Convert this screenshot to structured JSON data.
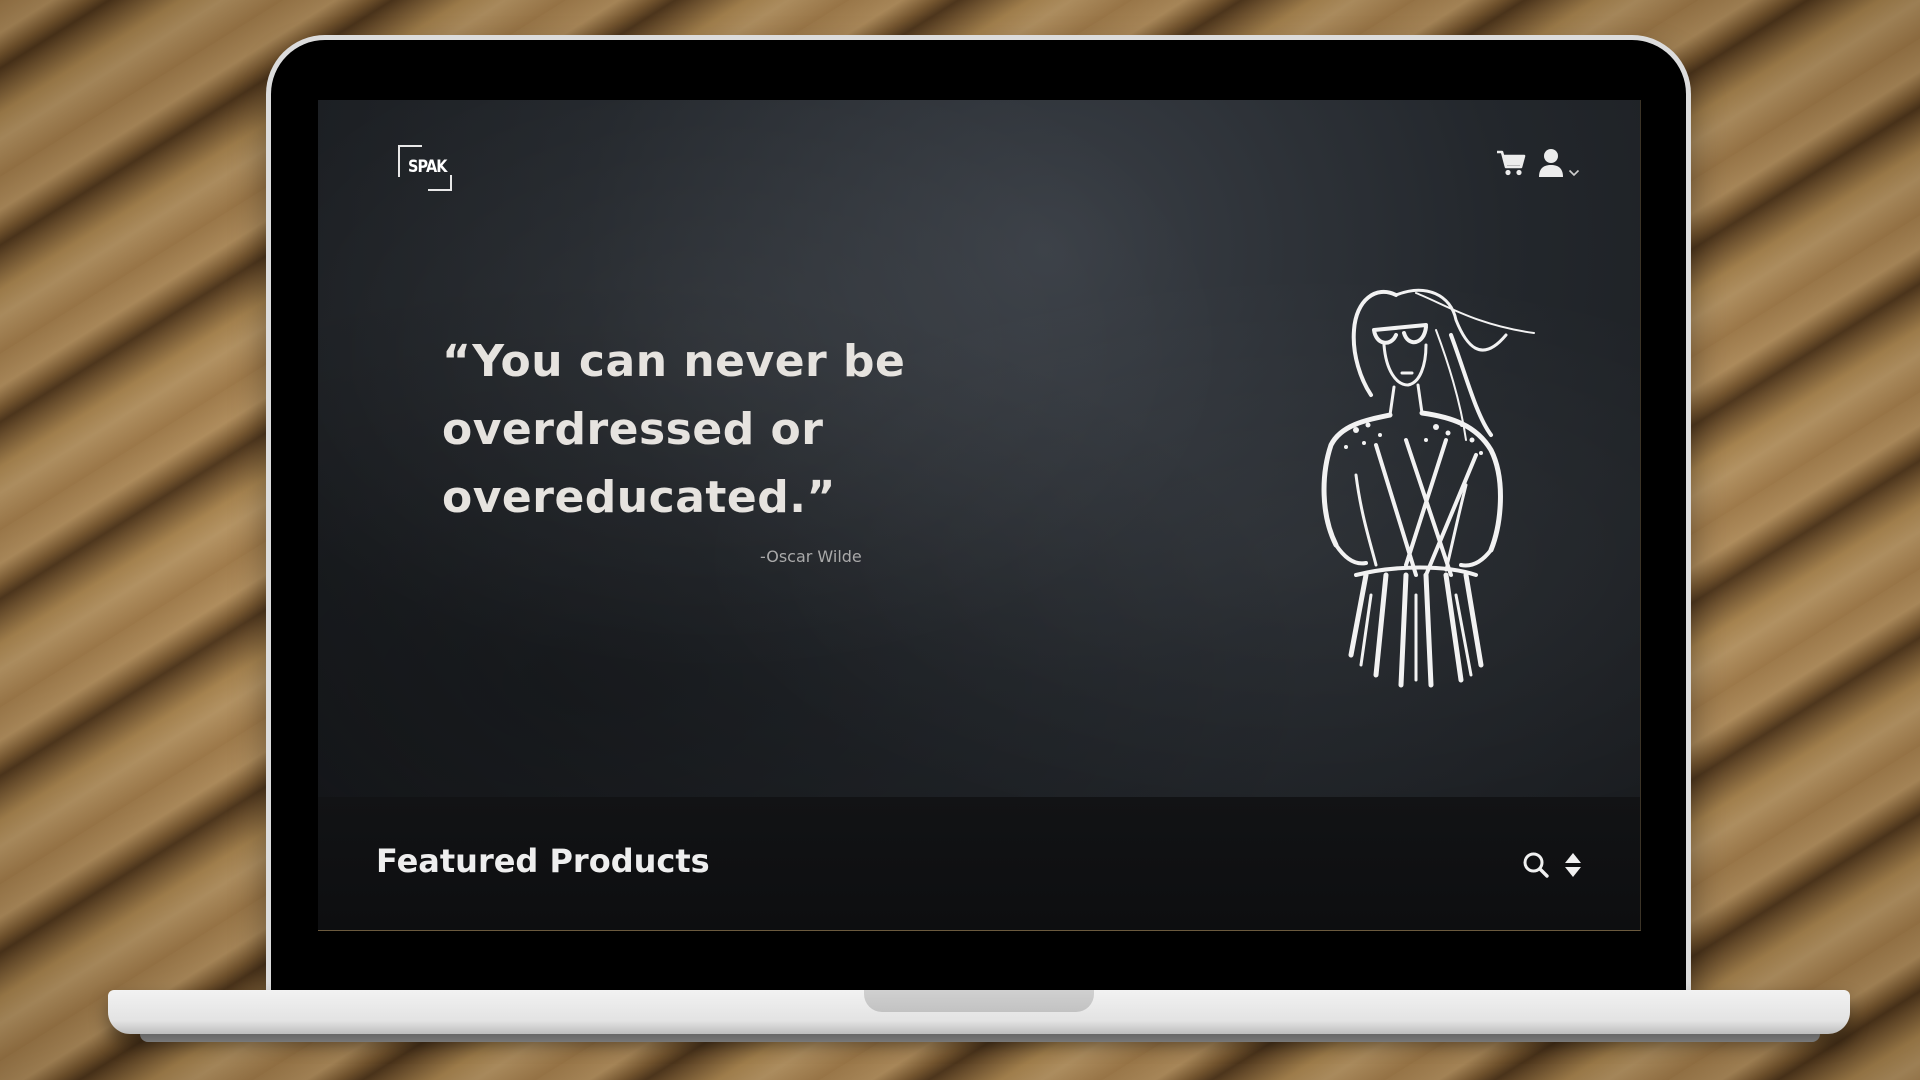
{
  "logo": {
    "text": "SPAK"
  },
  "header": {
    "icons": [
      "cart-icon",
      "user-icon",
      "chevron-down-icon"
    ]
  },
  "hero": {
    "quote_lines": [
      "“You can never be",
      "overdressed or",
      "overeducated.”"
    ],
    "author": "-Oscar Wilde"
  },
  "featured": {
    "title": "Featured Products",
    "icons": [
      "search-icon",
      "sort-icon"
    ]
  },
  "colors": {
    "screen_bg": "#23272c",
    "quote_text": "#e6e3df",
    "author_text": "#a9a9a9",
    "bar_bg": "#0f1012"
  }
}
